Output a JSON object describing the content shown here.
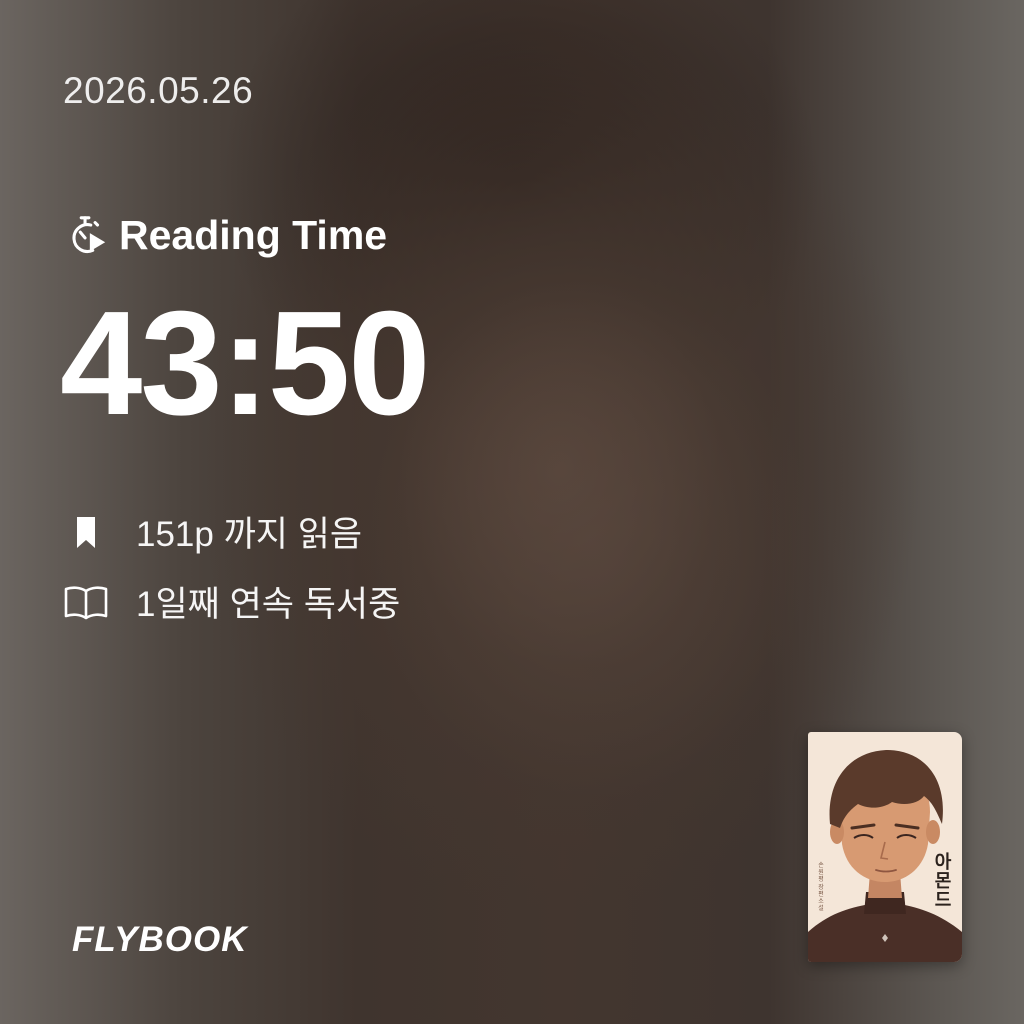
{
  "date": "2026.05.26",
  "reading": {
    "label": "Reading Time",
    "icon": "stopwatch-play-icon",
    "time": "43:50"
  },
  "stats": [
    {
      "icon": "bookmark-icon",
      "text": "151p 까지 읽음"
    },
    {
      "icon": "open-book-icon",
      "text": "1일째 연속 독서중"
    }
  ],
  "brand": "FLYBOOK",
  "book": {
    "title": "아몬드",
    "subtitle": "손원평 장편소설"
  },
  "colors": {
    "text": "#ffffff",
    "background": "#4a3f38",
    "cover_background": "#f4e6d8"
  }
}
